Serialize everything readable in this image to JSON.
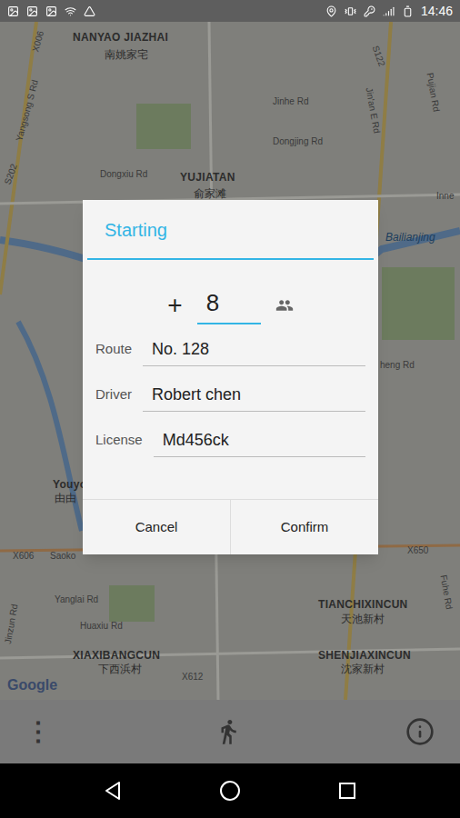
{
  "status_bar": {
    "time": "14:46"
  },
  "map": {
    "labels": [
      {
        "text": "X006",
        "kind": "road"
      },
      {
        "text": "NANYAO JIAZHAI",
        "kind": "place"
      },
      {
        "text": "南姚家宅",
        "kind": "place_zh"
      },
      {
        "text": "S122",
        "kind": "road"
      },
      {
        "text": "Yangsong S Rd",
        "kind": "road"
      },
      {
        "text": "Jinhe Rd",
        "kind": "road"
      },
      {
        "text": "Jin'an E Rd",
        "kind": "road"
      },
      {
        "text": "Pujian Rd",
        "kind": "road"
      },
      {
        "text": "Dongjing Rd",
        "kind": "road"
      },
      {
        "text": "Dongxiu Rd",
        "kind": "road"
      },
      {
        "text": "S202",
        "kind": "road"
      },
      {
        "text": "YUJIATAN",
        "kind": "place"
      },
      {
        "text": "俞家滩",
        "kind": "place_zh"
      },
      {
        "text": "Inne",
        "kind": "road"
      },
      {
        "text": "Bailianjing",
        "kind": "water"
      },
      {
        "text": "heng Rd",
        "kind": "road"
      },
      {
        "text": "Youyo",
        "kind": "place"
      },
      {
        "text": "由由",
        "kind": "place_zh"
      },
      {
        "text": "X606",
        "kind": "road"
      },
      {
        "text": "Saoko",
        "kind": "road"
      },
      {
        "text": "X650",
        "kind": "road"
      },
      {
        "text": "Yanglai Rd",
        "kind": "road"
      },
      {
        "text": "Jinzun Rd",
        "kind": "road"
      },
      {
        "text": "Huaxiu Rd",
        "kind": "road"
      },
      {
        "text": "TIANCHIXINCUN",
        "kind": "place"
      },
      {
        "text": "天池新村",
        "kind": "place_zh"
      },
      {
        "text": "XIAXIBANGCUN",
        "kind": "place"
      },
      {
        "text": "下西浜村",
        "kind": "place_zh"
      },
      {
        "text": "SHENJIAXINCUN",
        "kind": "place"
      },
      {
        "text": "沈家新村",
        "kind": "place_zh"
      },
      {
        "text": "X612",
        "kind": "road"
      },
      {
        "text": "Fuhe Rd",
        "kind": "road"
      }
    ],
    "attribution": "Google"
  },
  "dialog": {
    "title": "Starting",
    "passenger_prefix": "+",
    "passengers": "8",
    "fields": [
      {
        "label": "Route",
        "value": "No. 128"
      },
      {
        "label": "Driver",
        "value": "Robert chen"
      },
      {
        "label": "License",
        "value": "Md456ck"
      }
    ],
    "buttons": [
      "Cancel",
      "Confirm"
    ]
  },
  "toolbar": {
    "menu": "⋮"
  }
}
